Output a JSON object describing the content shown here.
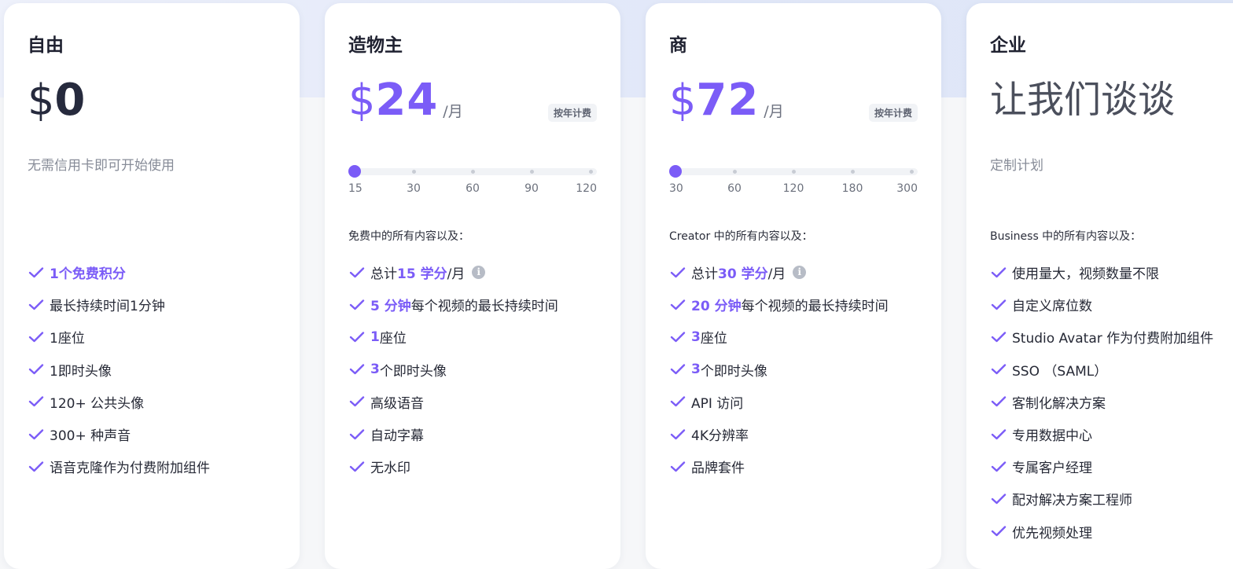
{
  "plans": [
    {
      "name": "自由",
      "currency": "$",
      "price": "0",
      "subtitle": "无需信用卡即可开始使用",
      "features": [
        {
          "highlight": "",
          "text": "1个免费积分",
          "strong": true
        },
        {
          "highlight": "",
          "text": "最长持续时间1分钟"
        },
        {
          "highlight": "",
          "text": "1座位"
        },
        {
          "highlight": "",
          "text": "1即时头像"
        },
        {
          "highlight": "",
          "text": "120+ 公共头像"
        },
        {
          "highlight": "",
          "text": "300+ 种声音"
        },
        {
          "highlight": "",
          "text": "语音克隆作为付费附加组件"
        }
      ]
    },
    {
      "name": "造物主",
      "currency": "$",
      "price": "24",
      "per": "/月",
      "badge": "按年计费",
      "slider": {
        "labels": [
          "15",
          "30",
          "60",
          "90",
          "120"
        ],
        "selected_index": 0
      },
      "intro": "免费中的所有内容以及：",
      "features": [
        {
          "prefix": "总计 ",
          "highlight": "15 学分",
          "text": "/月",
          "info": true
        },
        {
          "highlight": "5 分钟",
          "text": "每个视频的最长持续时间"
        },
        {
          "highlight": "1",
          "text": "座位"
        },
        {
          "highlight": "3",
          "text": " 个即时头像"
        },
        {
          "highlight": "",
          "text": "高级语音"
        },
        {
          "highlight": "",
          "text": "自动字幕"
        },
        {
          "highlight": "",
          "text": "无水印"
        }
      ]
    },
    {
      "name": "商",
      "currency": "$",
      "price": "72",
      "per": "/月",
      "badge": "按年计费",
      "slider": {
        "labels": [
          "30",
          "60",
          "120",
          "180",
          "300"
        ],
        "selected_index": 0
      },
      "intro": "Creator 中的所有内容以及：",
      "features": [
        {
          "prefix": "总计 ",
          "highlight": "30 学分",
          "text": "/月",
          "info": true
        },
        {
          "highlight": "20 分钟",
          "text": "每个视频的最长持续时间"
        },
        {
          "highlight": "3",
          "text": " 座位"
        },
        {
          "highlight": "3",
          "text": " 个即时头像"
        },
        {
          "highlight": "",
          "text": "API 访问"
        },
        {
          "highlight": "",
          "text": "4K分辨率"
        },
        {
          "highlight": "",
          "text": "品牌套件"
        }
      ]
    },
    {
      "name": "企业",
      "price_text": "让我们谈谈",
      "subtitle": "定制计划",
      "intro": "Business 中的所有内容以及：",
      "features": [
        {
          "highlight": "",
          "text": "使用量大，视频数量不限"
        },
        {
          "highlight": "",
          "text": "自定义席位数"
        },
        {
          "highlight": "",
          "text": "Studio Avatar 作为付费附加组件"
        },
        {
          "highlight": "",
          "text": "SSO （SAML）"
        },
        {
          "highlight": "",
          "text": "客制化解决方案"
        },
        {
          "highlight": "",
          "text": "专用数据中心"
        },
        {
          "highlight": "",
          "text": "专属客户经理"
        },
        {
          "highlight": "",
          "text": "配对解决方案工程师"
        },
        {
          "highlight": "",
          "text": "优先视频处理"
        }
      ]
    }
  ],
  "colors": {
    "accent": "#7b5cf7",
    "text": "#262936",
    "muted": "#878c98"
  },
  "icons": {
    "feature": "check-icon",
    "info": "info-icon"
  }
}
